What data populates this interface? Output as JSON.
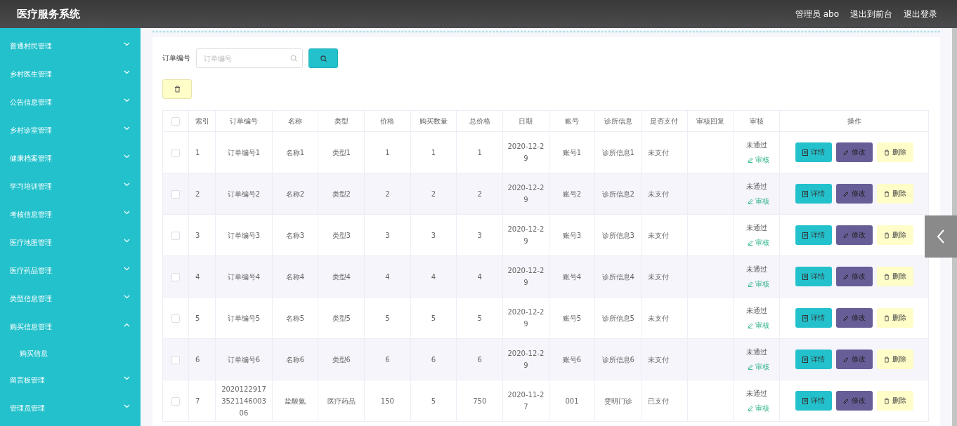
{
  "header": {
    "title": "医疗服务系统",
    "user": "管理员 abo",
    "links": [
      "退出到前台",
      "退出登录"
    ]
  },
  "sidebar": {
    "items": [
      {
        "label": "普通村民管理",
        "expanded": false
      },
      {
        "label": "乡村医生管理",
        "expanded": false
      },
      {
        "label": "公告信息管理",
        "expanded": false
      },
      {
        "label": "乡村诊室管理",
        "expanded": false
      },
      {
        "label": "健康档案管理",
        "expanded": false
      },
      {
        "label": "学习培训管理",
        "expanded": false
      },
      {
        "label": "考核信息管理",
        "expanded": false
      },
      {
        "label": "医疗地图管理",
        "expanded": false
      },
      {
        "label": "医疗药品管理",
        "expanded": false
      },
      {
        "label": "类型信息管理",
        "expanded": false
      },
      {
        "label": "购买信息管理",
        "expanded": true,
        "children": [
          {
            "label": "购买信息"
          }
        ]
      },
      {
        "label": "留言板管理",
        "expanded": false
      },
      {
        "label": "管理员管理",
        "expanded": false
      }
    ]
  },
  "search": {
    "label": "订单编号",
    "placeholder": "订单编号"
  },
  "table": {
    "select_all": false,
    "columns": [
      "索引",
      "订单编号",
      "名称",
      "类型",
      "价格",
      "购买数量",
      "总价格",
      "日期",
      "账号",
      "诊所信息",
      "是否支付",
      "审核回复",
      "审核",
      "操作"
    ],
    "rows": [
      {
        "checked": false,
        "cells": [
          "1",
          "订单编号1",
          "名称1",
          "类型1",
          "1",
          "1",
          "1",
          "2020-12-29",
          "账号1",
          "诊所信息1",
          "未支付",
          ""
        ],
        "status": "未通过",
        "review": "审核",
        "actions": [
          {
            "kind": "detail",
            "label": "详情"
          },
          {
            "kind": "edit",
            "label": "修改"
          },
          {
            "kind": "delete",
            "label": "删除"
          }
        ]
      },
      {
        "checked": false,
        "cells": [
          "2",
          "订单编号2",
          "名称2",
          "类型2",
          "2",
          "2",
          "2",
          "2020-12-29",
          "账号2",
          "诊所信息2",
          "未支付",
          ""
        ],
        "status": "未通过",
        "review": "审核",
        "actions": [
          {
            "kind": "detail",
            "label": "详情"
          },
          {
            "kind": "edit",
            "label": "修改"
          },
          {
            "kind": "delete",
            "label": "删除"
          }
        ]
      },
      {
        "checked": false,
        "cells": [
          "3",
          "订单编号3",
          "名称3",
          "类型3",
          "3",
          "3",
          "3",
          "2020-12-29",
          "账号3",
          "诊所信息3",
          "未支付",
          ""
        ],
        "status": "未通过",
        "review": "审核",
        "actions": [
          {
            "kind": "detail",
            "label": "详情"
          },
          {
            "kind": "edit",
            "label": "修改"
          },
          {
            "kind": "delete",
            "label": "删除"
          }
        ]
      },
      {
        "checked": false,
        "cells": [
          "4",
          "订单编号4",
          "名称4",
          "类型4",
          "4",
          "4",
          "4",
          "2020-12-29",
          "账号4",
          "诊所信息4",
          "未支付",
          ""
        ],
        "status": "未通过",
        "review": "审核",
        "actions": [
          {
            "kind": "detail",
            "label": "详情"
          },
          {
            "kind": "edit",
            "label": "修改"
          },
          {
            "kind": "delete",
            "label": "删除"
          }
        ]
      },
      {
        "checked": false,
        "cells": [
          "5",
          "订单编号5",
          "名称5",
          "类型5",
          "5",
          "5",
          "5",
          "2020-12-29",
          "账号5",
          "诊所信息5",
          "未支付",
          ""
        ],
        "status": "未通过",
        "review": "审核",
        "actions": [
          {
            "kind": "detail",
            "label": "详情"
          },
          {
            "kind": "edit",
            "label": "修改"
          },
          {
            "kind": "delete",
            "label": "删除"
          }
        ]
      },
      {
        "checked": false,
        "cells": [
          "6",
          "订单编号6",
          "名称6",
          "类型6",
          "6",
          "6",
          "6",
          "2020-12-29",
          "账号6",
          "诊所信息6",
          "未支付",
          ""
        ],
        "status": "未通过",
        "review": "审核",
        "actions": [
          {
            "kind": "detail",
            "label": "详情"
          },
          {
            "kind": "edit",
            "label": "修改"
          },
          {
            "kind": "delete",
            "label": "删除"
          }
        ]
      },
      {
        "checked": false,
        "cells": [
          "7",
          "2020122917352114600306",
          "盐酸氨",
          "医疗药品",
          "150",
          "5",
          "750",
          "2020-11-27",
          "001",
          "雯明门诊",
          "已支付",
          ""
        ],
        "status": "未通过",
        "review": "审核",
        "actions": [
          {
            "kind": "detail",
            "label": "详情"
          },
          {
            "kind": "edit",
            "label": "修改"
          },
          {
            "kind": "delete",
            "label": "删除"
          }
        ]
      }
    ]
  }
}
